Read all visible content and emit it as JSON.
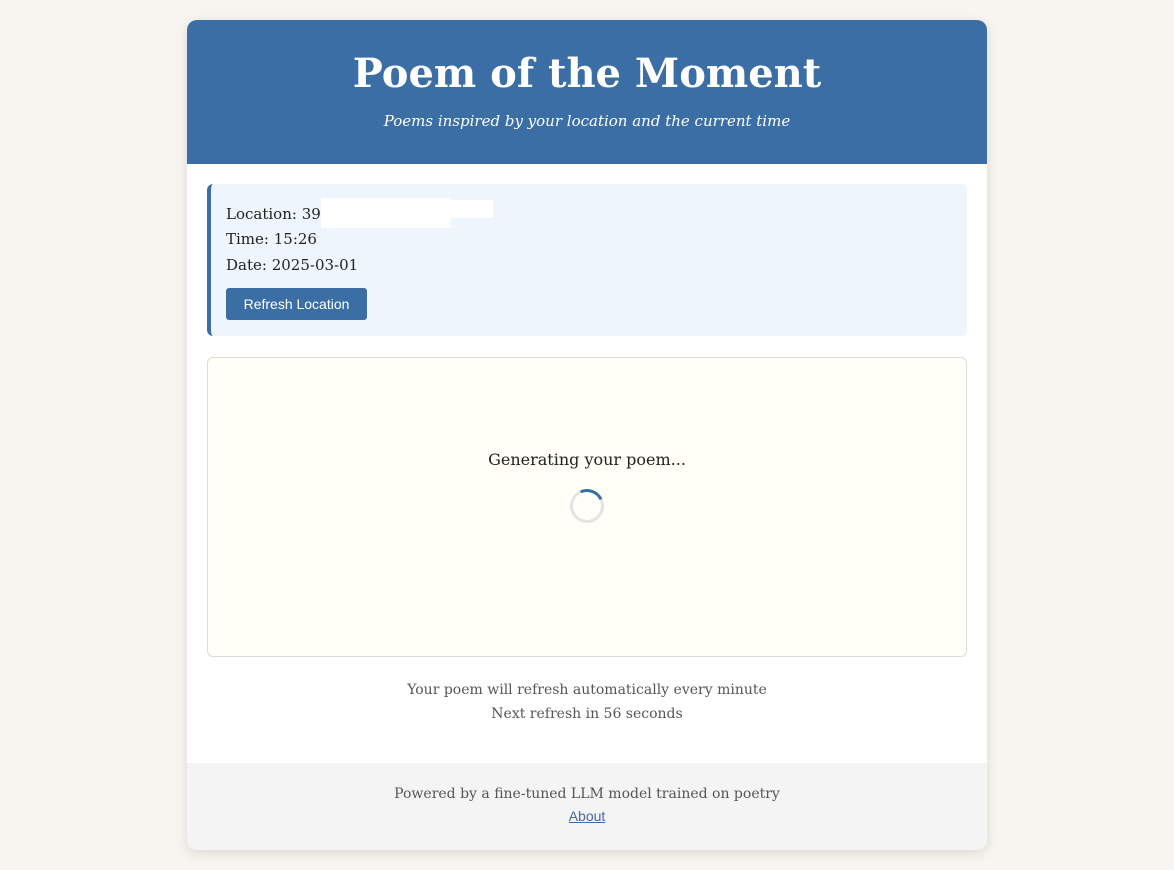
{
  "header": {
    "title": "Poem of the Moment",
    "subtitle": "Poems inspired by your location and the current time"
  },
  "info": {
    "location_label": "Location:",
    "location_value_visible": "39",
    "time_label": "Time:",
    "time_value": "15:26",
    "date_label": "Date:",
    "date_value": "2025-03-01",
    "refresh_button": "Refresh Location"
  },
  "poem": {
    "status": "Generating your poem..."
  },
  "refresh": {
    "line1": "Your poem will refresh automatically every minute",
    "line2": "Next refresh in 56 seconds"
  },
  "footer": {
    "text": "Powered by a fine-tuned LLM model trained on poetry",
    "about_link": "About"
  },
  "colors": {
    "primary": "#3b6ea5",
    "page_bg": "#f8f5f1",
    "info_bg": "#eef5fd",
    "poem_bg": "#fffef7"
  }
}
